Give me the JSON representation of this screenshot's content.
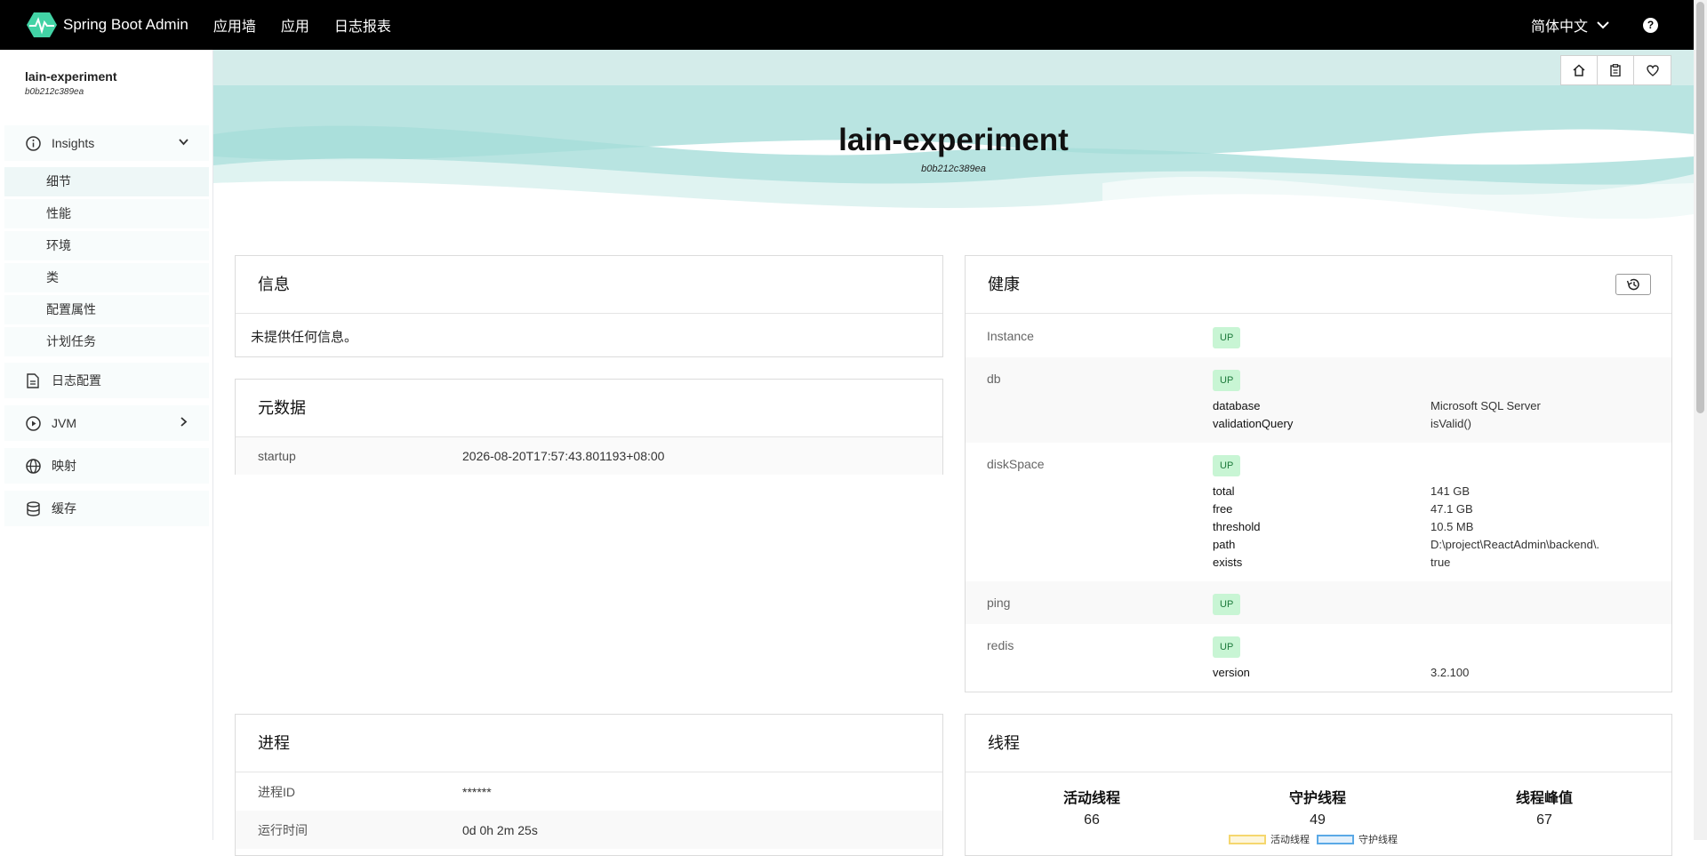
{
  "topbar": {
    "brand": "Spring Boot Admin",
    "nav": [
      "应用墙",
      "应用",
      "日志报表"
    ],
    "language": "简体中文",
    "help": "?"
  },
  "sidebar": {
    "app_name": "lain-experiment",
    "app_id": "b0b212c389ea",
    "insights_label": "Insights",
    "insights_items": [
      "细节",
      "性能",
      "环境",
      "类",
      "配置属性",
      "计划任务"
    ],
    "items": [
      "日志配置",
      "JVM",
      "映射",
      "缓存"
    ]
  },
  "header": {
    "title": "lain-experiment",
    "subtitle": "b0b212c389ea"
  },
  "info": {
    "title": "信息",
    "empty": "未提供任何信息。"
  },
  "metadata": {
    "title": "元数据",
    "rows": [
      {
        "key": "startup",
        "value": "2026-08-20T17:57:43.801193+08:00"
      }
    ]
  },
  "health": {
    "title": "健康",
    "instance": {
      "name": "Instance",
      "status": "UP"
    },
    "db": {
      "name": "db",
      "status": "UP",
      "details": [
        {
          "k": "database",
          "v": "Microsoft SQL Server"
        },
        {
          "k": "validationQuery",
          "v": "isValid()"
        }
      ]
    },
    "disk": {
      "name": "diskSpace",
      "status": "UP",
      "details": [
        {
          "k": "total",
          "v": "141 GB"
        },
        {
          "k": "free",
          "v": "47.1 GB"
        },
        {
          "k": "threshold",
          "v": "10.5 MB"
        },
        {
          "k": "path",
          "v": "D:\\project\\ReactAdmin\\backend\\."
        },
        {
          "k": "exists",
          "v": "true"
        }
      ]
    },
    "ping": {
      "name": "ping",
      "status": "UP"
    },
    "redis": {
      "name": "redis",
      "status": "UP",
      "details": [
        {
          "k": "version",
          "v": "3.2.100"
        }
      ]
    }
  },
  "process": {
    "title": "进程",
    "rows": [
      {
        "key": "进程ID",
        "value": "******"
      },
      {
        "key": "运行时间",
        "value": "0d 0h 2m 25s"
      }
    ]
  },
  "threads": {
    "title": "线程",
    "stats": [
      {
        "label": "活动线程",
        "value": "66"
      },
      {
        "label": "守护线程",
        "value": "49"
      },
      {
        "label": "线程峰值",
        "value": "67"
      }
    ],
    "legend": [
      "活动线程",
      "守护线程"
    ]
  },
  "colors": {
    "accent": "#42d3a5",
    "badge_bg": "#c8f5d4",
    "badge_text": "#1d7a3b"
  }
}
